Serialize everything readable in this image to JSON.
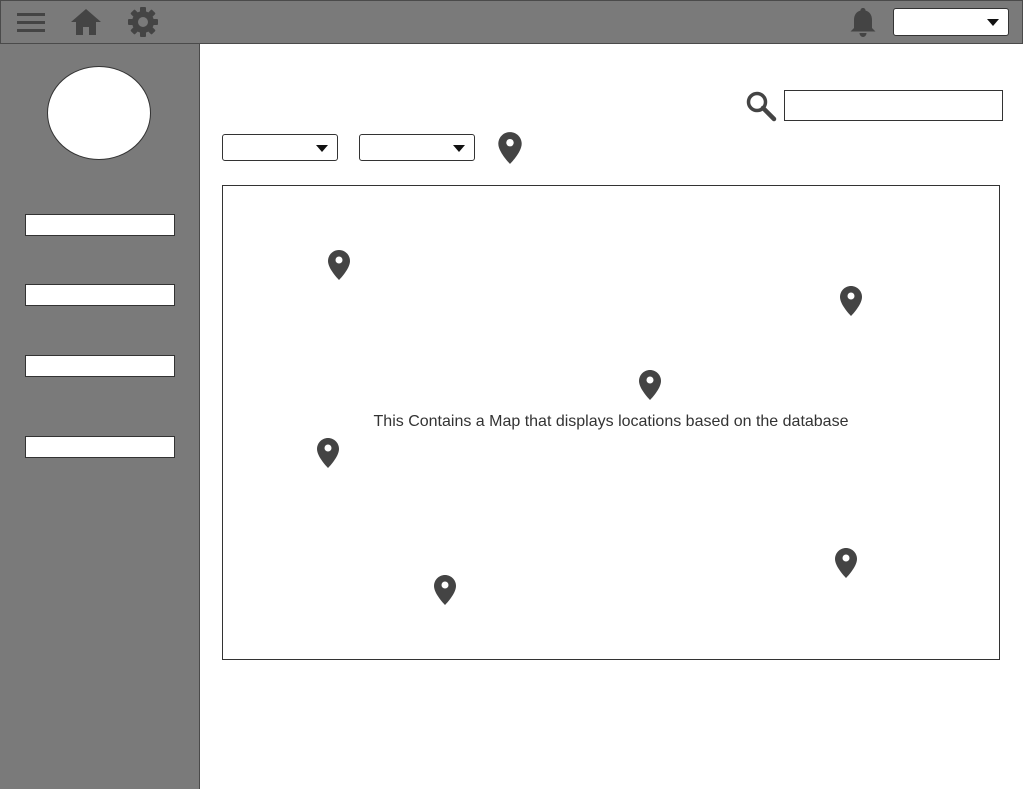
{
  "header": {
    "icons": [
      "hamburger-menu-icon",
      "home-icon",
      "gear-icon",
      "bell-icon"
    ],
    "account_dropdown_value": ""
  },
  "sidebar": {
    "items": [
      {
        "value": ""
      },
      {
        "value": ""
      },
      {
        "value": ""
      },
      {
        "value": ""
      }
    ]
  },
  "search": {
    "value": "",
    "icon": "search-icon"
  },
  "filters": {
    "dropdown_1_value": "",
    "dropdown_2_value": "",
    "location_icon": "map-pin-icon"
  },
  "map": {
    "placeholder_text": "This Contains a Map that displays locations based on the database",
    "marker_count": 6
  },
  "colors": {
    "panel": "#7a7a7a",
    "border": "#4a4a4a",
    "icon": "#444444",
    "background": "#ffffff"
  }
}
